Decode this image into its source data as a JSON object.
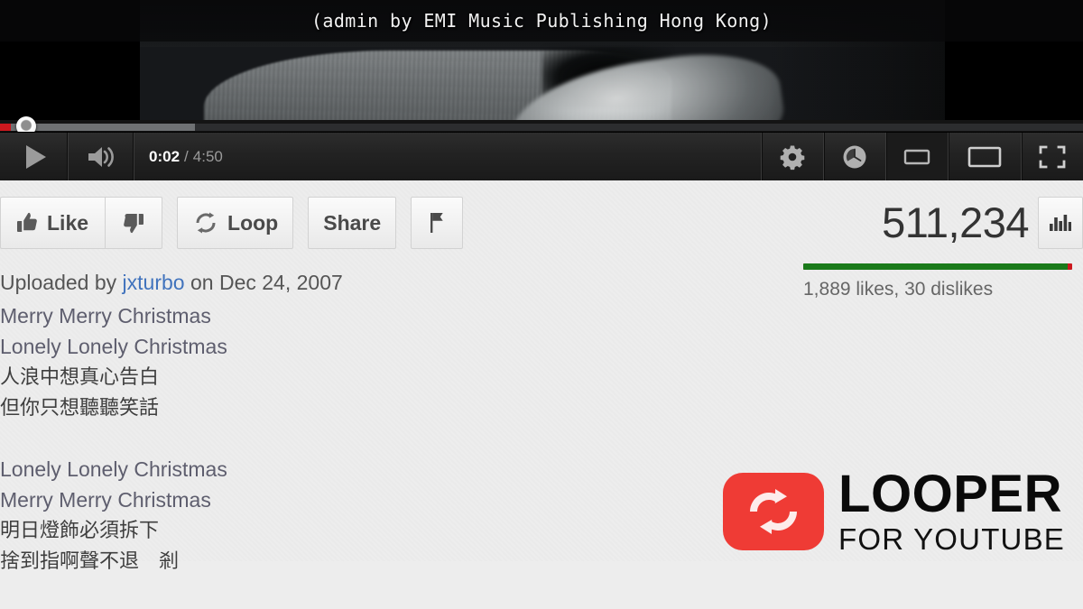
{
  "player": {
    "caption": "(admin by EMI Music Publishing Hong Kong)",
    "current_time": "0:02",
    "time_separator": "/",
    "duration": "4:50",
    "play_button_label": "Play",
    "volume_label": "Volume",
    "settings_label": "Settings",
    "watch_later_label": "Watch Later",
    "small_player_label": "Small player",
    "theater_label": "Theater mode",
    "fullscreen_label": "Fullscreen",
    "progress": {
      "played_percent": 1,
      "loaded_percent": 18,
      "knob_position_percent": 2
    },
    "icons": {
      "play": "play-icon",
      "volume": "volume-icon",
      "settings": "gear-icon",
      "watch_later": "clock-icon",
      "small_player": "small-screen-icon",
      "theater": "theater-screen-icon",
      "fullscreen": "fullscreen-icon"
    }
  },
  "actions": {
    "like_label": "Like",
    "dislike_label": "Dislike",
    "loop_label": "Loop",
    "share_label": "Share",
    "flag_label": "Flag",
    "stats_label": "Statistics"
  },
  "stats": {
    "view_count": "511,234",
    "rating_text": "1,889 likes, 30 dislikes",
    "likes": 1889,
    "dislikes": 30,
    "like_ratio_percent": 98.4
  },
  "upload": {
    "prefix": "Uploaded by",
    "uploader": "jxturbo",
    "middle": "on",
    "date": "Dec 24, 2007"
  },
  "description": {
    "lines": [
      "Merry Merry Christmas",
      "Lonely Lonely Christmas",
      "人浪中想真心告白",
      "但你只想聽聽笑話",
      "",
      "Lonely Lonely Christmas",
      "Merry Merry Christmas",
      "明日燈飾必須拆下",
      "捨到指啊聲不退　剎"
    ],
    "cjk_flags": [
      false,
      false,
      true,
      true,
      false,
      false,
      false,
      true,
      true
    ]
  },
  "branding": {
    "title": "LOOPER",
    "subtitle": "FOR YOUTUBE",
    "accent_color": "#ef3b35",
    "icon": "loop-arrows-icon"
  },
  "colors": {
    "page_background": "#ededed",
    "player_background": "#000000",
    "control_bar": "#232323",
    "progress_played": "#cc181e",
    "progress_loaded": "#6f7173",
    "like_bar": "#1a7a1a",
    "dislike_bar": "#cc181e",
    "link": "#4173bd",
    "view_count": "#333333"
  }
}
